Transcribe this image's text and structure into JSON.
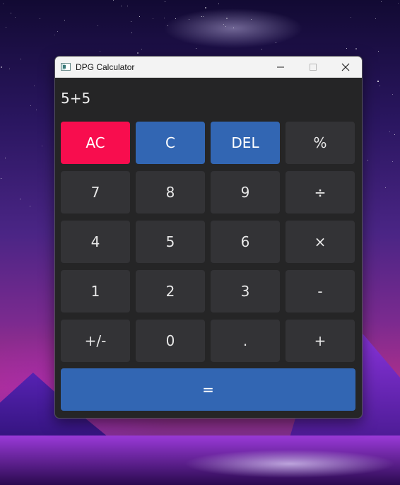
{
  "window": {
    "title": "DPG Calculator",
    "icon": "calculator-app-icon",
    "controls": [
      "minimize-icon",
      "maximize-icon",
      "close-icon"
    ]
  },
  "display": {
    "expression": "5+5"
  },
  "keys": {
    "ac": "AC",
    "c": "C",
    "del": "DEL",
    "percent": "%",
    "seven": "7",
    "eight": "8",
    "nine": "9",
    "divide": "÷",
    "four": "4",
    "five": "5",
    "six": "6",
    "multiply": "×",
    "one": "1",
    "two": "2",
    "three": "3",
    "minus": "-",
    "negate": "+/-",
    "zero": "0",
    "decimal": ".",
    "plus": "+",
    "equals": "="
  },
  "colors": {
    "clear_all": "#f80d4e",
    "accent": "#3266b3",
    "key": "#333336",
    "window_bg": "#252526"
  }
}
